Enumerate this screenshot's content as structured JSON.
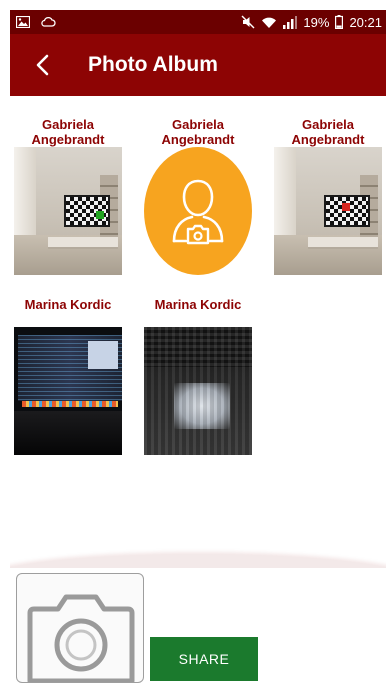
{
  "status_bar": {
    "battery": "19%",
    "time": "20:21",
    "icons": [
      "gallery-icon",
      "cloud-icon",
      "mute-icon",
      "wifi-icon",
      "signal-icon",
      "battery-icon"
    ]
  },
  "app_bar": {
    "title": "Photo Album",
    "back_icon": "back-arrow-icon"
  },
  "photos": [
    {
      "owner": "Gabriela Angebrandt",
      "kind": "room-photo",
      "marker_color": "#1fa31f"
    },
    {
      "owner": "Gabriela Angebrandt",
      "kind": "avatar-placeholder",
      "icon": "user-camera-icon"
    },
    {
      "owner": "Gabriela Angebrandt",
      "kind": "room-photo",
      "marker_color": "#d8261f"
    },
    {
      "owner": "Marina Kordic",
      "kind": "laptop-photo"
    },
    {
      "owner": "Marina Kordic",
      "kind": "curtain-photo"
    }
  ],
  "bottom": {
    "camera_icon": "camera-icon",
    "share_label": "SHARE"
  },
  "colors": {
    "status_bar": "#6b0000",
    "app_bar": "#8d0404",
    "owner_text": "#8d0404",
    "avatar_bg": "#f7a41f",
    "share_button": "#1b7a2d"
  }
}
